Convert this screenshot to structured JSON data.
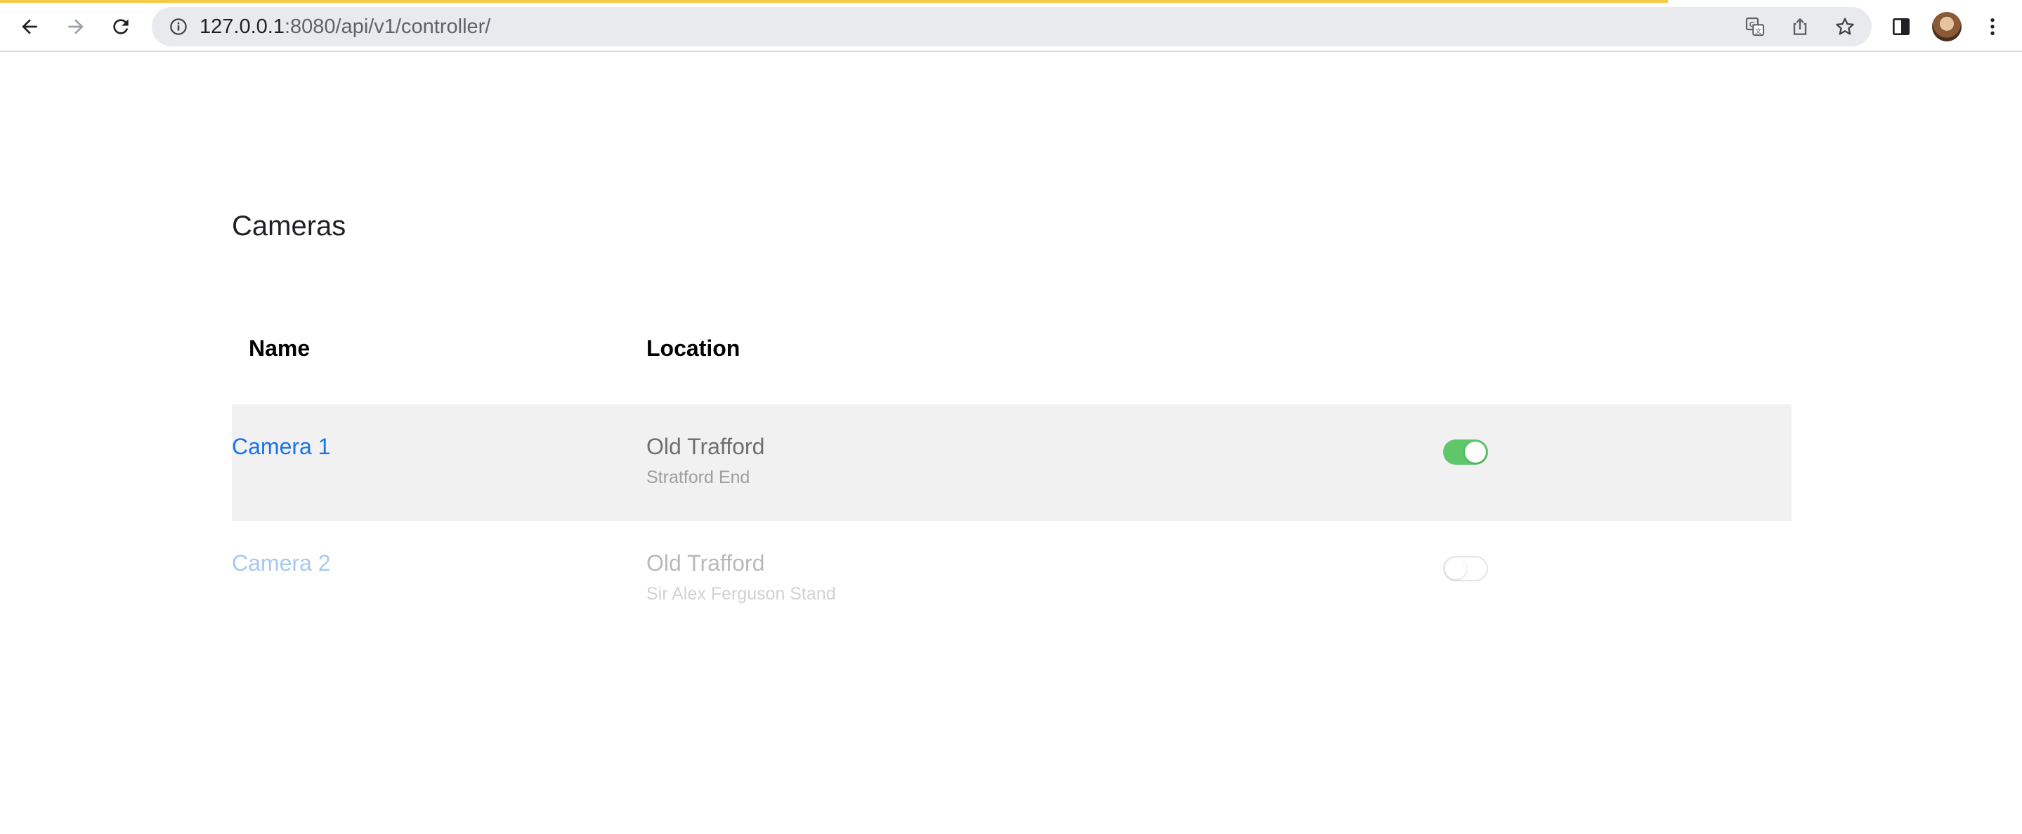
{
  "browser": {
    "url_host": "127.0.0.1",
    "url_path": ":8080/api/v1/controller/",
    "loading_progress": 0.825,
    "colors": {
      "loading_bar": "#f7c948",
      "omnibox_bg": "#e8eaed"
    },
    "icons": {
      "back": "back-arrow-icon",
      "forward": "forward-arrow-icon",
      "reload": "reload-icon",
      "site_info": "info-icon",
      "translate": "translate-icon",
      "share": "share-icon",
      "bookmark": "star-icon",
      "side_panel": "side-panel-icon",
      "profile": "avatar",
      "menu": "kebab-menu-icon"
    }
  },
  "page": {
    "title": "Cameras",
    "table": {
      "columns": [
        "Name",
        "Location"
      ],
      "rows": [
        {
          "name": "Camera 1",
          "location": "Old Trafford",
          "sublocation": "Stratford End",
          "enabled": true
        },
        {
          "name": "Camera 2",
          "location": "Old Trafford",
          "sublocation": "Sir Alex Ferguson Stand",
          "enabled": false
        }
      ]
    },
    "colors": {
      "link": "#1a73e8",
      "toggle_on": "#5fc76a",
      "active_row_bg": "#f1f1f1"
    }
  }
}
